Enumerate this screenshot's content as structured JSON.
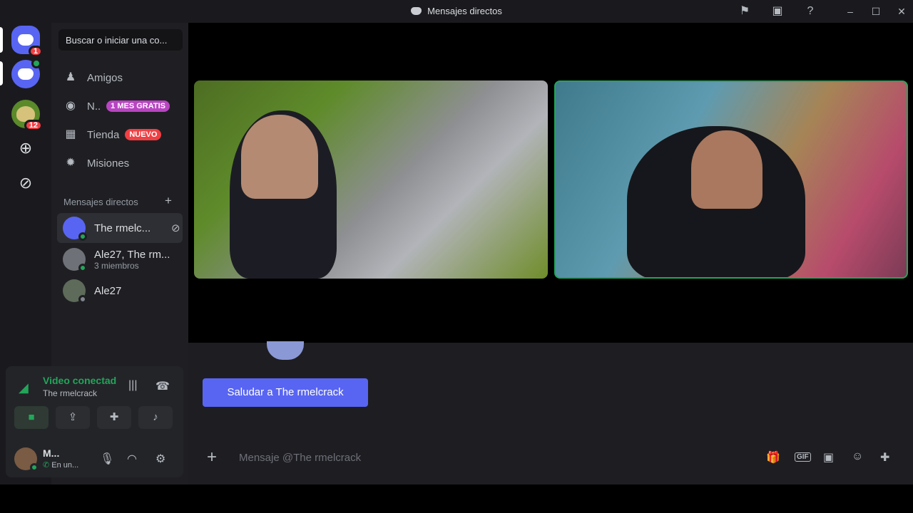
{
  "titlebar": {
    "title": "Mensajes directos",
    "icons": [
      "inbox-flag-icon",
      "screen-record-icon",
      "help-icon"
    ],
    "window_controls": [
      "minimize",
      "maximize",
      "close"
    ]
  },
  "rail": {
    "servers": [
      {
        "name": "home",
        "badge": "1"
      },
      {
        "name": "server-2",
        "badge": ""
      },
      {
        "name": "server-link",
        "badge": "12"
      }
    ],
    "add_server_icon": "plus-circle-icon",
    "discover_icon": "compass-icon"
  },
  "sidebar": {
    "search_placeholder": "Buscar o iniciar una co...",
    "nav": [
      {
        "label": "Amigos",
        "icon": "friends-icon",
        "tag": ""
      },
      {
        "label": "N..",
        "icon": "nitro-icon",
        "tag": "1 MES GRATIS",
        "tag_color": "#b845c1"
      },
      {
        "label": "Tienda",
        "icon": "shop-icon",
        "tag": "NUEVO",
        "tag_color": "#f23f43"
      },
      {
        "label": "Misiones",
        "icon": "quests-icon",
        "tag": ""
      }
    ],
    "dm_header": "Mensajes directos",
    "dms": [
      {
        "name": "The rmelc...",
        "sub": "",
        "status": "online",
        "active": true
      },
      {
        "name": "Ale27, The rm...",
        "sub": "3 miembros",
        "status": "online",
        "active": false
      },
      {
        "name": "Ale27",
        "sub": "",
        "status": "offline",
        "active": false
      }
    ]
  },
  "voice": {
    "status": "Video conectad",
    "channel": "The rmelcrack",
    "user": {
      "name": "M...",
      "status": "En un..."
    }
  },
  "main": {
    "greet_button": "Saludar a The rmelcrack",
    "composer_placeholder": "Mensaje @The rmelcrack",
    "composer_icons": [
      "gift-icon",
      "gif-icon",
      "sticker-icon",
      "emoji-icon",
      "apps-icon"
    ]
  },
  "colors": {
    "brand": "#5865f2",
    "online": "#23a55a",
    "danger": "#f23f43"
  }
}
